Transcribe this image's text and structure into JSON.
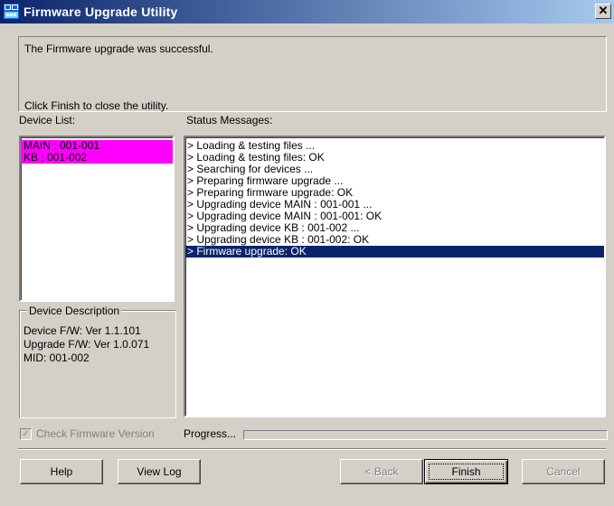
{
  "window": {
    "title": "Firmware Upgrade Utility",
    "close_glyph": "✕",
    "icon": "app-icon"
  },
  "message": {
    "line1": "The Firmware upgrade was successful.",
    "line2": "Click Finish to close the utility."
  },
  "device_list": {
    "label": "Device List:",
    "items": [
      "MAIN : 001-001",
      "KB : 001-002"
    ],
    "highlight_color": "#ff00ff"
  },
  "status": {
    "label": "Status Messages:",
    "items": [
      "> Loading & testing files ...",
      "> Loading & testing files: OK",
      "> Searching for devices ...",
      "> Preparing firmware upgrade ...",
      "> Preparing firmware upgrade: OK",
      "> Upgrading device MAIN : 001-001 ...",
      "> Upgrading device MAIN : 001-001: OK",
      "> Upgrading device KB : 001-002 ...",
      "> Upgrading device KB : 001-002: OK",
      "> Firmware upgrade: OK"
    ],
    "selected_index": 9,
    "selected_color": "#0a246a"
  },
  "device_description": {
    "title": "Device Description",
    "device_fw": "Device F/W: Ver 1.1.101",
    "upgrade_fw": "Upgrade F/W: Ver 1.0.071",
    "mid": "MID: 001-002"
  },
  "check_firmware": {
    "label": "Check Firmware Version",
    "checked": true,
    "enabled": false
  },
  "progress": {
    "label": "Progress...",
    "value": 0
  },
  "buttons": {
    "help": "Help",
    "view_log": "View Log",
    "back": "< Back",
    "finish": "Finish",
    "cancel": "Cancel"
  }
}
